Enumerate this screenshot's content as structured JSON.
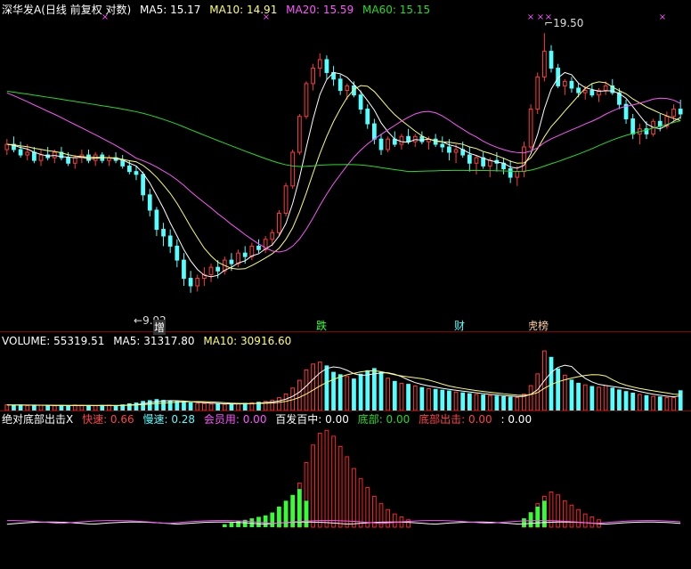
{
  "colors": {
    "background": "#000000",
    "panel_separator": "#8b0000",
    "candle_up": "#ff3b3b",
    "candle_down": "#54ffff",
    "ma5": "#ffffff",
    "ma10": "#ffff66",
    "ma20": "#ff55ff",
    "ma60": "#22dd22",
    "label_white": "#ffffff",
    "label_yellow": "#ffff66",
    "label_magenta": "#ff55ff",
    "label_green": "#22dd22",
    "label_red": "#ff4444",
    "label_cyan": "#54ffff",
    "indicator_white": "#ffffff",
    "indicator_magenta": "#ff55ff",
    "indicator_green": "#33ff33",
    "indicator_red": "#ff2222"
  },
  "header": {
    "title": "深华发A(日线 前复权 对数)",
    "ma5": "MA5: 15.17",
    "ma10": "MA10: 14.91",
    "ma20": "MA20: 15.59",
    "ma60": "MA60: 15.15"
  },
  "volume_header": {
    "label": "VOLUME: 55319.51",
    "ma5": "MA5: 31317.80",
    "ma10": "MA10: 30916.60"
  },
  "indicator_header": {
    "name": "绝对底部出击X",
    "fast": "快速: 0.66",
    "slow": "慢速: 0.28",
    "member": "会员用: 0.00",
    "hundred": "百发百中: 0.00",
    "bottom": "底部: 0.00",
    "bottom_strike": "底部出击: 0.00",
    "last": ": 0.00"
  },
  "annotations": {
    "high": "19.50",
    "low": "9.92",
    "tag_zeng": "增",
    "tag_die": "跌",
    "tag_cai": "财",
    "tag_bang": "龙虎榜"
  },
  "chart_data": {
    "type": "candlestick",
    "x": "trading days (unlabeled)",
    "y_log_scale": true,
    "ylim": [
      9.4,
      20.2
    ],
    "price_high_marked": 19.5,
    "price_low_marked": 9.92,
    "candles_ohlc": [
      [
        14.4,
        14.8,
        14.2,
        14.6
      ],
      [
        14.6,
        14.9,
        14.3,
        14.4
      ],
      [
        14.4,
        14.7,
        14.1,
        14.2
      ],
      [
        14.2,
        14.6,
        14.0,
        14.3
      ],
      [
        14.3,
        14.5,
        13.9,
        14.0
      ],
      [
        14.0,
        14.4,
        13.8,
        14.2
      ],
      [
        14.2,
        14.5,
        14.0,
        14.1
      ],
      [
        14.1,
        14.4,
        13.9,
        14.3
      ],
      [
        14.3,
        14.5,
        14.0,
        14.1
      ],
      [
        14.1,
        14.3,
        13.8,
        13.9
      ],
      [
        13.9,
        14.2,
        13.7,
        14.1
      ],
      [
        14.1,
        14.4,
        13.9,
        14.2
      ],
      [
        14.2,
        14.4,
        13.9,
        14.0
      ],
      [
        14.0,
        14.3,
        13.8,
        14.2
      ],
      [
        14.2,
        14.3,
        13.9,
        14.0
      ],
      [
        14.0,
        14.2,
        13.8,
        14.1
      ],
      [
        14.1,
        14.3,
        13.9,
        14.0
      ],
      [
        14.0,
        14.2,
        13.7,
        13.8
      ],
      [
        13.8,
        14.0,
        13.5,
        13.6
      ],
      [
        13.6,
        13.8,
        13.3,
        13.5
      ],
      [
        13.5,
        13.6,
        12.6,
        12.8
      ],
      [
        12.8,
        13.0,
        12.1,
        12.3
      ],
      [
        12.3,
        12.4,
        11.5,
        11.7
      ],
      [
        11.7,
        11.9,
        11.2,
        11.5
      ],
      [
        11.5,
        11.7,
        11.0,
        11.2
      ],
      [
        11.2,
        11.4,
        10.6,
        10.8
      ],
      [
        10.8,
        11.0,
        10.1,
        10.3
      ],
      [
        10.3,
        10.5,
        9.92,
        10.1
      ],
      [
        10.1,
        10.4,
        9.95,
        10.3
      ],
      [
        10.3,
        10.6,
        10.1,
        10.4
      ],
      [
        10.4,
        10.7,
        10.2,
        10.6
      ],
      [
        10.6,
        10.8,
        10.3,
        10.5
      ],
      [
        10.5,
        10.9,
        10.4,
        10.8
      ],
      [
        10.8,
        11.0,
        10.5,
        10.7
      ],
      [
        10.7,
        11.1,
        10.6,
        11.0
      ],
      [
        11.0,
        11.2,
        10.7,
        10.9
      ],
      [
        10.9,
        11.3,
        10.8,
        11.2
      ],
      [
        11.2,
        11.4,
        11.0,
        11.1
      ],
      [
        11.1,
        11.5,
        11.0,
        11.4
      ],
      [
        11.4,
        11.7,
        11.2,
        11.6
      ],
      [
        11.6,
        12.3,
        11.5,
        12.2
      ],
      [
        12.2,
        13.2,
        12.1,
        13.1
      ],
      [
        13.1,
        14.4,
        13.0,
        14.3
      ],
      [
        14.3,
        15.8,
        14.2,
        15.7
      ],
      [
        15.7,
        17.2,
        15.6,
        17.1
      ],
      [
        17.1,
        18.0,
        16.8,
        17.8
      ],
      [
        17.8,
        18.5,
        17.4,
        18.2
      ],
      [
        18.2,
        18.4,
        17.3,
        17.6
      ],
      [
        17.6,
        17.9,
        17.0,
        17.3
      ],
      [
        17.3,
        17.5,
        16.6,
        16.8
      ],
      [
        16.8,
        17.1,
        16.4,
        17.0
      ],
      [
        17.0,
        17.2,
        16.5,
        16.6
      ],
      [
        16.6,
        16.8,
        15.8,
        16.0
      ],
      [
        16.0,
        16.2,
        15.2,
        15.4
      ],
      [
        15.4,
        15.6,
        14.6,
        14.8
      ],
      [
        14.8,
        15.0,
        14.2,
        14.4
      ],
      [
        14.4,
        14.9,
        14.3,
        14.8
      ],
      [
        14.8,
        15.1,
        14.5,
        14.6
      ],
      [
        14.6,
        15.0,
        14.4,
        14.9
      ],
      [
        14.9,
        15.2,
        14.6,
        14.7
      ],
      [
        14.7,
        15.0,
        14.5,
        14.9
      ],
      [
        14.9,
        15.1,
        14.6,
        14.7
      ],
      [
        14.7,
        14.9,
        14.4,
        14.8
      ],
      [
        14.8,
        15.0,
        14.5,
        14.6
      ],
      [
        14.6,
        14.9,
        14.3,
        14.5
      ],
      [
        14.5,
        14.8,
        14.0,
        14.3
      ],
      [
        14.3,
        14.6,
        13.9,
        14.4
      ],
      [
        14.4,
        14.7,
        14.1,
        14.2
      ],
      [
        14.2,
        14.5,
        13.6,
        13.9
      ],
      [
        13.9,
        14.2,
        13.5,
        14.1
      ],
      [
        14.1,
        14.3,
        13.7,
        13.8
      ],
      [
        13.8,
        14.1,
        13.4,
        14.0
      ],
      [
        14.0,
        14.3,
        13.6,
        13.9
      ],
      [
        13.9,
        14.1,
        13.5,
        13.7
      ],
      [
        13.7,
        14.0,
        13.2,
        13.4
      ],
      [
        13.4,
        13.8,
        13.1,
        13.6
      ],
      [
        13.6,
        14.7,
        13.4,
        14.5
      ],
      [
        14.5,
        16.2,
        14.4,
        16.0
      ],
      [
        16.0,
        17.6,
        15.8,
        17.4
      ],
      [
        17.4,
        19.5,
        17.2,
        18.6
      ],
      [
        18.6,
        18.9,
        17.6,
        17.8
      ],
      [
        17.8,
        18.0,
        16.9,
        17.0
      ],
      [
        17.0,
        17.3,
        16.6,
        17.2
      ],
      [
        17.2,
        17.4,
        16.7,
        16.9
      ],
      [
        16.9,
        17.1,
        16.5,
        16.7
      ],
      [
        16.7,
        17.0,
        16.4,
        16.8
      ],
      [
        16.8,
        17.1,
        16.5,
        16.6
      ],
      [
        16.6,
        16.9,
        16.3,
        16.8
      ],
      [
        16.8,
        17.2,
        16.6,
        17.0
      ],
      [
        17.0,
        17.3,
        16.6,
        16.7
      ],
      [
        16.7,
        16.9,
        16.0,
        16.2
      ],
      [
        16.2,
        16.4,
        15.4,
        15.6
      ],
      [
        15.6,
        15.8,
        14.8,
        15.0
      ],
      [
        15.0,
        15.4,
        14.6,
        15.2
      ],
      [
        15.2,
        15.5,
        14.8,
        15.0
      ],
      [
        15.0,
        15.6,
        14.9,
        15.5
      ],
      [
        15.5,
        15.8,
        15.1,
        15.3
      ],
      [
        15.3,
        15.9,
        15.2,
        15.7
      ],
      [
        15.7,
        16.2,
        15.5,
        16.0
      ],
      [
        16.0,
        16.4,
        15.6,
        15.8
      ]
    ],
    "volume": [
      4200,
      3800,
      4100,
      3600,
      3900,
      4000,
      3700,
      3500,
      3800,
      3600,
      4100,
      3900,
      3700,
      3600,
      3800,
      4000,
      3500,
      4200,
      5000,
      5600,
      6800,
      7400,
      8200,
      7600,
      7000,
      6600,
      6200,
      5800,
      5400,
      5200,
      4800,
      5000,
      4600,
      4800,
      5200,
      5400,
      5800,
      6200,
      6800,
      7600,
      9600,
      12400,
      16800,
      22600,
      30400,
      34800,
      36200,
      33400,
      28600,
      26800,
      25400,
      23600,
      27200,
      29800,
      31400,
      28600,
      24200,
      21800,
      20400,
      19600,
      18400,
      17200,
      16400,
      15800,
      15200,
      14600,
      13800,
      13200,
      12600,
      12000,
      11600,
      11200,
      10800,
      10400,
      10000,
      9600,
      12200,
      18600,
      27400,
      44600,
      39800,
      31200,
      26400,
      22800,
      20400,
      19200,
      18000,
      17400,
      18600,
      16800,
      15400,
      14200,
      13000,
      12000,
      11200,
      10600,
      10200,
      9800,
      9600,
      14800
    ],
    "volume_ma5_last": 31317.8,
    "volume_ma10_last": 30916.6,
    "indicator_red": [
      0,
      0,
      0,
      0,
      0,
      0,
      0,
      0,
      0,
      0,
      0,
      0,
      0,
      0,
      0,
      0,
      0,
      0,
      0,
      0,
      0,
      0,
      0,
      0,
      0,
      0,
      0,
      0,
      0,
      0,
      0,
      0,
      0,
      0,
      0,
      0,
      0,
      0,
      0,
      0,
      0.05,
      0.1,
      0.18,
      0.3,
      0.44,
      0.56,
      0.64,
      0.66,
      0.62,
      0.55,
      0.48,
      0.4,
      0.33,
      0.27,
      0.21,
      0.16,
      0.12,
      0.09,
      0.07,
      0.05,
      0,
      0,
      0,
      0,
      0,
      0,
      0,
      0,
      0,
      0,
      0,
      0,
      0,
      0,
      0,
      0,
      0.04,
      0.1,
      0.16,
      0.21,
      0.24,
      0.22,
      0.18,
      0.15,
      0.12,
      0.09,
      0.07,
      0.05,
      0,
      0,
      0,
      0,
      0,
      0,
      0,
      0,
      0,
      0,
      0,
      0
    ],
    "indicator_green": [
      0,
      0,
      0,
      0,
      0,
      0,
      0,
      0,
      0,
      0,
      0,
      0,
      0,
      0,
      0,
      0,
      0,
      0,
      0,
      0,
      0,
      0,
      0,
      0,
      0,
      0,
      0,
      0,
      0,
      0,
      0,
      0,
      0.02,
      0.03,
      0.04,
      0.05,
      0.06,
      0.07,
      0.08,
      0.1,
      0.14,
      0.18,
      0.22,
      0.26,
      0.18,
      0,
      0,
      0,
      0,
      0,
      0,
      0,
      0,
      0,
      0,
      0,
      0,
      0,
      0,
      0,
      0,
      0,
      0,
      0,
      0,
      0,
      0,
      0,
      0,
      0,
      0,
      0,
      0,
      0,
      0,
      0,
      0.06,
      0.1,
      0.14,
      0.18,
      0,
      0,
      0,
      0,
      0,
      0,
      0,
      0,
      0,
      0,
      0,
      0,
      0,
      0,
      0,
      0,
      0,
      0,
      0,
      0
    ],
    "indicator_fast_last": 0.66,
    "indicator_slow_last": 0.28,
    "signal_marks_top": [
      118,
      299,
      596,
      607,
      616,
      744
    ]
  }
}
